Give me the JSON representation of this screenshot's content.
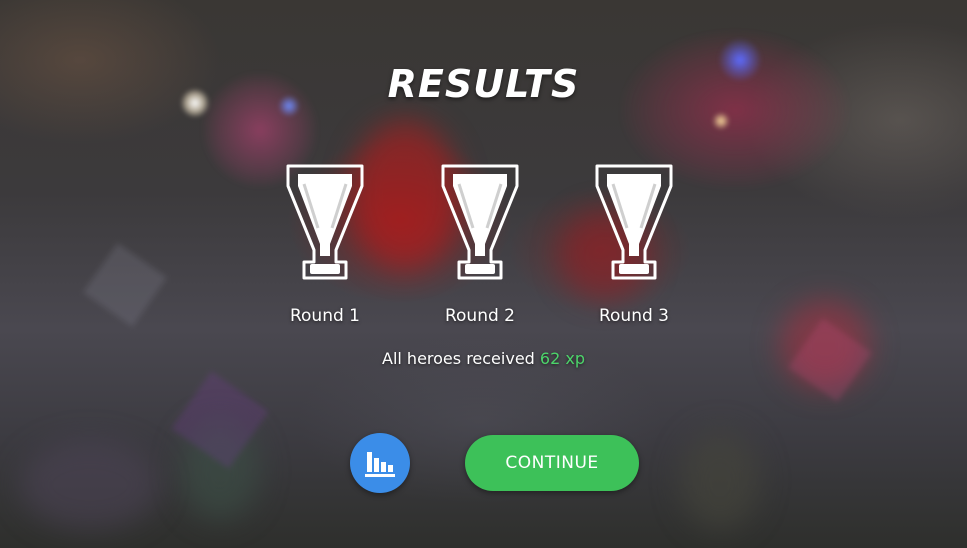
{
  "screen": {
    "title": "RESULTS",
    "rounds": [
      {
        "label": "Round 1"
      },
      {
        "label": "Round 2"
      },
      {
        "label": "Round 3"
      }
    ],
    "reward": {
      "prefix": "All heroes received",
      "value": "62 xp"
    },
    "buttons": {
      "stats_icon": "bar-chart-icon",
      "continue_label": "CONTINUE"
    }
  },
  "colors": {
    "title": "#ffffff",
    "xp_value": "#4cd46a",
    "stats_button": "#3b8de8",
    "continue_button": "#3dc159"
  }
}
